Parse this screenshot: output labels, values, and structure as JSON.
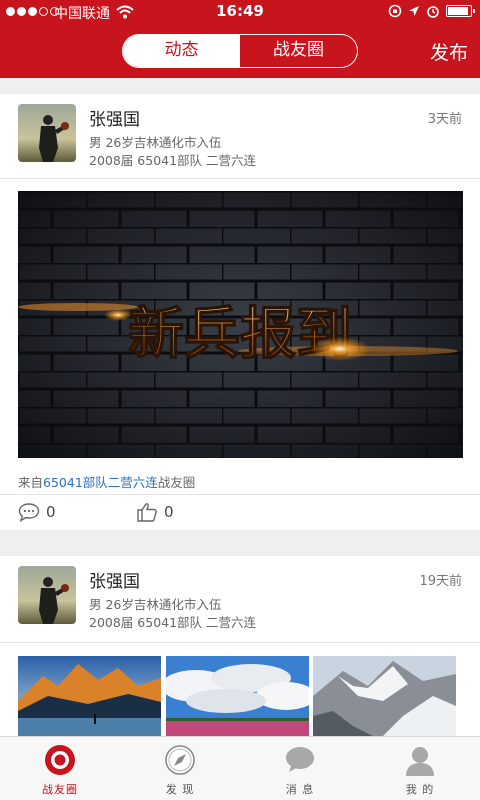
{
  "status_bar": {
    "carrier": "中国联通",
    "time": "16:49",
    "battery_level": 0.9
  },
  "nav": {
    "tabs": [
      {
        "label": "动态",
        "active": true
      },
      {
        "label": "战友圈",
        "active": false
      }
    ],
    "publish_label": "发布"
  },
  "posts": [
    {
      "author": "张强国",
      "time_ago": "3天前",
      "info_line1": "男 26岁吉林通化市入伍",
      "info_line2": "2008届 65041部队 二营六连",
      "image_caption": "新兵报到",
      "source_prefix": "来自",
      "source_link": "65041部队二营六连",
      "source_suffix": "战友圈",
      "comment_count": "0",
      "like_count": "0"
    },
    {
      "author": "张强国",
      "time_ago": "19天前",
      "info_line1": "男 26岁吉林通化市入伍",
      "info_line2": "2008届 65041部队 二营六连"
    }
  ],
  "tabbar": {
    "items": [
      {
        "label": "战友圈",
        "icon": "circle-target-icon",
        "active": true
      },
      {
        "label": "发 现",
        "icon": "compass-icon",
        "active": false
      },
      {
        "label": "消 息",
        "icon": "chat-bubble-icon",
        "active": false
      },
      {
        "label": "我 的",
        "icon": "person-icon",
        "active": false
      }
    ]
  },
  "colors": {
    "brand_red": "#c8141c",
    "link_blue": "#2a6fc9"
  }
}
